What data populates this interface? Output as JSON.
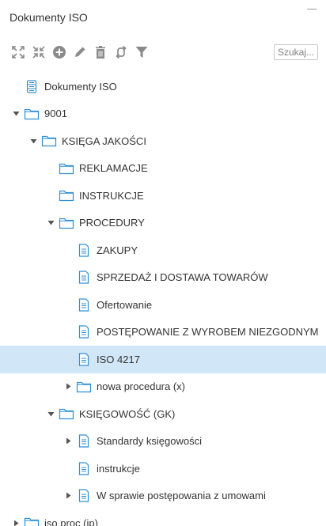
{
  "panel": {
    "title": "Dokumenty ISO"
  },
  "toolbar": {
    "search_placeholder": "Szukaj...",
    "icons": [
      "expand-all-icon",
      "collapse-all-icon",
      "add-circle-icon",
      "pencil-icon",
      "trash-icon",
      "refresh-icon",
      "filter-icon"
    ]
  },
  "tree": [
    {
      "label": "Dokumenty ISO",
      "depth": 0,
      "icon": "database-icon",
      "caret": "none"
    },
    {
      "label": "9001",
      "depth": 0,
      "icon": "folder-icon",
      "caret": "expanded"
    },
    {
      "label": "KSIĘGA JAKOŚCI",
      "depth": 1,
      "icon": "folder-icon",
      "caret": "expanded"
    },
    {
      "label": "REKLAMACJE",
      "depth": 2,
      "icon": "folder-icon",
      "caret": "none"
    },
    {
      "label": "INSTRUKCJE",
      "depth": 2,
      "icon": "folder-icon",
      "caret": "none"
    },
    {
      "label": "PROCEDURY",
      "depth": 2,
      "icon": "folder-icon",
      "caret": "expanded"
    },
    {
      "label": "ZAKUPY",
      "depth": 3,
      "icon": "document-icon",
      "caret": "none"
    },
    {
      "label": "SPRZEDAŻ I DOSTAWA TOWARÓW",
      "depth": 3,
      "icon": "document-icon",
      "caret": "none"
    },
    {
      "label": "Ofertowanie",
      "depth": 3,
      "icon": "document-icon",
      "caret": "none"
    },
    {
      "label": "POSTĘPOWANIE Z WYROBEM NIEZGODNYM",
      "depth": 3,
      "icon": "document-icon",
      "caret": "none"
    },
    {
      "label": "ISO 4217",
      "depth": 3,
      "icon": "document-icon",
      "caret": "none",
      "selected": true
    },
    {
      "label": "nowa procedura (x)",
      "depth": 3,
      "icon": "folder-icon",
      "caret": "collapsed"
    },
    {
      "label": "KSIĘGOWOŚĆ (GK)",
      "depth": 2,
      "icon": "folder-icon",
      "caret": "expanded"
    },
    {
      "label": "Standardy księgowości",
      "depth": 3,
      "icon": "document-icon",
      "caret": "collapsed"
    },
    {
      "label": "instrukcje",
      "depth": 3,
      "icon": "document-icon",
      "caret": "none"
    },
    {
      "label": "W sprawie postępowania z umowami",
      "depth": 3,
      "icon": "document-icon",
      "caret": "collapsed"
    },
    {
      "label": "iso proc (ip)",
      "depth": 0,
      "icon": "folder-icon",
      "caret": "collapsed"
    }
  ],
  "colors": {
    "accent": "#2f8fd6",
    "selected_bg": "#d1e6f6",
    "toolbar_icon": "#8a8a8a",
    "caret": "#555555"
  }
}
